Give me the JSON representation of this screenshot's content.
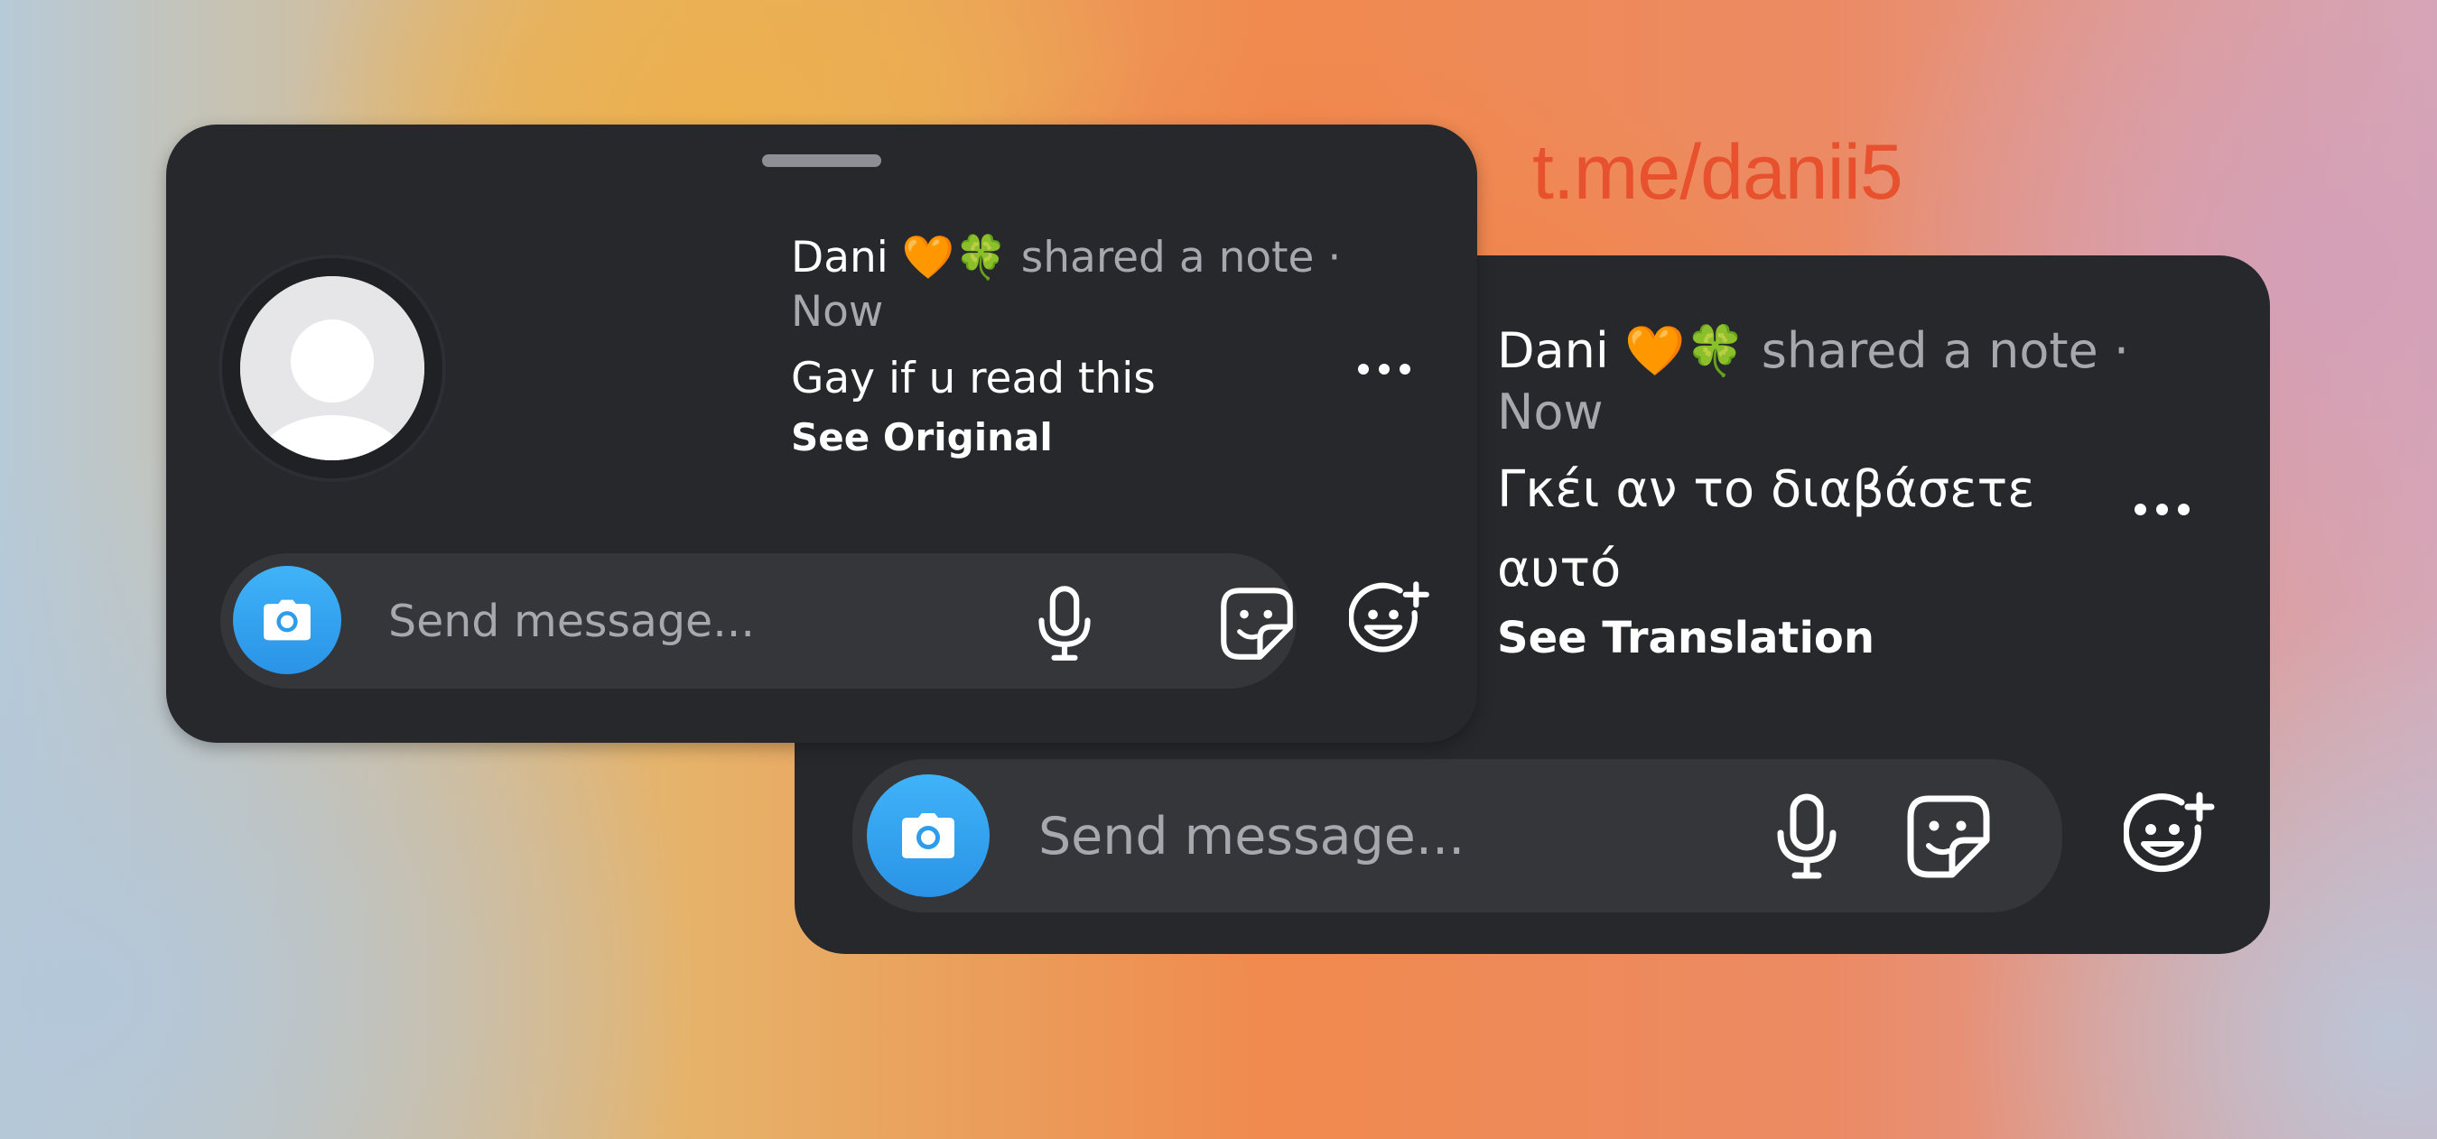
{
  "watermark": "t.me/danii5",
  "cards": {
    "original": {
      "author": "Dani 🧡🍀",
      "meta_line": " shared a note · Now",
      "note_text": "Gay if u read this",
      "link_label": "See Original",
      "composer": {
        "placeholder": "Send message..."
      }
    },
    "translated": {
      "author": "Dani 🧡🍀",
      "meta_line": " shared a note · Now",
      "note_text": "Γκέι αν το διαβάσετε αυτό",
      "link_label": "See Translation",
      "composer": {
        "placeholder": "Send message..."
      }
    }
  },
  "icons": {
    "avatar": "default-user-avatar",
    "camera": "camera-icon",
    "mic": "microphone-icon",
    "sticker": "sticker-icon",
    "reaction": "add-reaction-icon",
    "more": "more-options-icon"
  },
  "colors": {
    "card_background": "#26282c",
    "composer_background": "#35363a",
    "camera_button": "#3fb3f8",
    "muted_text": "#a6a8ad",
    "watermark": "#e8512d"
  }
}
